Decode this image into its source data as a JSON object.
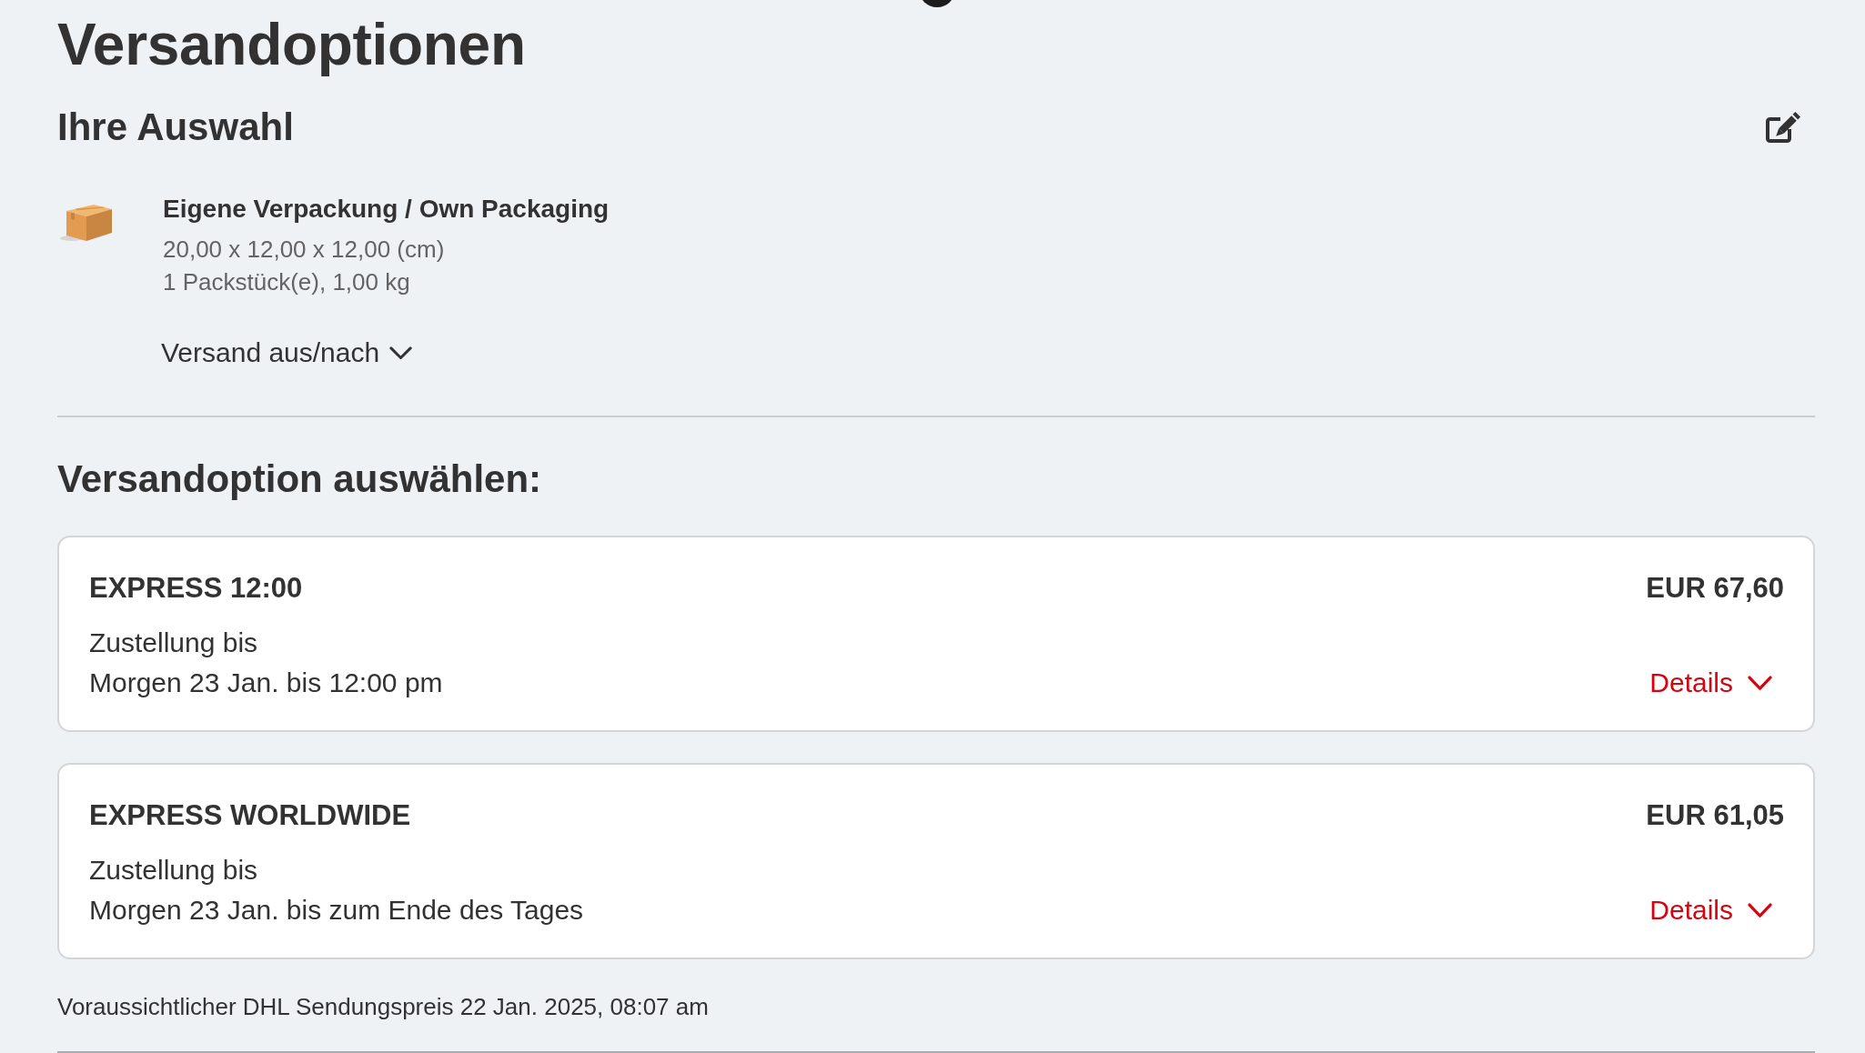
{
  "page": {
    "title": "Versandoptionen"
  },
  "selection": {
    "heading": "Ihre Auswahl",
    "package": {
      "name": "Eigene Verpackung / Own Packaging",
      "dimensions": "20,00 x 12,00 x 12,00 (cm)",
      "pieces": "1 Packstück(e), 1,00 kg"
    },
    "route_toggle": {
      "label": "Versand aus/nach",
      "expanded": false
    }
  },
  "options_heading": "Versandoption auswählen:",
  "options": [
    {
      "name": "EXPRESS 12:00",
      "price": "EUR 67,60",
      "delivery_label": "Zustellung bis",
      "delivery_time": "Morgen 23 Jan. bis 12:00 pm",
      "details_label": "Details",
      "expanded": false
    },
    {
      "name": "EXPRESS WORLDWIDE",
      "price": "EUR 61,05",
      "delivery_label": "Zustellung bis",
      "delivery_time": "Morgen 23 Jan. bis zum Ende des Tages",
      "details_label": "Details",
      "expanded": false
    }
  ],
  "footer_note": "Voraussichtlicher DHL Sendungspreis 22 Jan. 2025, 08:07 am"
}
